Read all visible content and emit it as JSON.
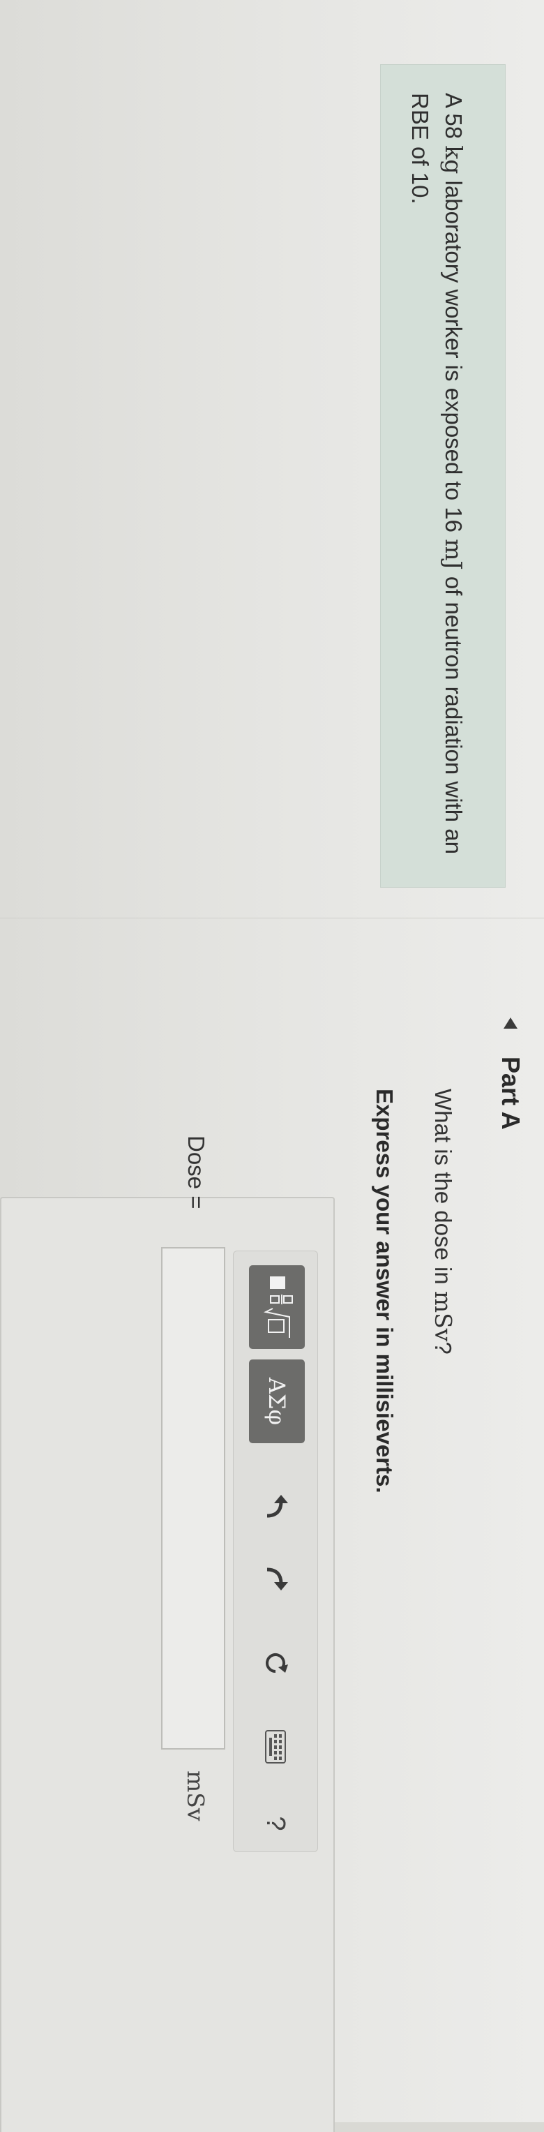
{
  "problem": {
    "text_before": "A 58 ",
    "mass_unit": "kg",
    "text_middle": " laboratory worker is exposed to 16 ",
    "energy_unit": "mJ",
    "text_after": " of neutron radiation with an RBE of 10."
  },
  "part": {
    "label": "Part A",
    "toggle_icon": "caret-down-icon"
  },
  "question": {
    "prefix": "What is the dose in ",
    "unit": "mSv",
    "suffix": "?"
  },
  "instruction": "Express your answer in millisieverts.",
  "toolbar": {
    "templates_icon": "templates-icon",
    "greek_label": "ΑΣφ",
    "undo_icon": "undo-icon",
    "redo_icon": "redo-icon",
    "reset_icon": "reset-icon",
    "keyboard_icon": "keyboard-icon",
    "help_label": "?"
  },
  "answer": {
    "label": "Dose =",
    "value": "",
    "unit": "mSv"
  },
  "colors": {
    "problem_bg": "#d4dfd8",
    "button_bg": "#6c6c6a",
    "page_bg": "#e6e6e3"
  }
}
